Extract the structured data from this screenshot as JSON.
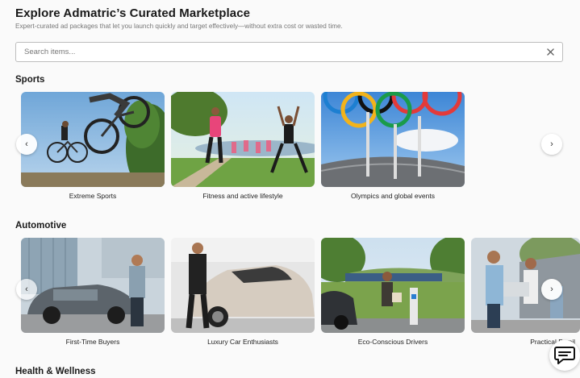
{
  "header": {
    "title": "Explore Admatric’s Curated Marketplace",
    "subtitle": "Expert-curated ad packages that let you launch quickly and target effectively—without extra cost or wasted time."
  },
  "search": {
    "placeholder": "Search items...",
    "value": ""
  },
  "sections": [
    {
      "title": "Sports",
      "cards": [
        {
          "caption": "Extreme Sports"
        },
        {
          "caption": "Fitness and active lifestyle"
        },
        {
          "caption": "Olympics and global events"
        }
      ]
    },
    {
      "title": "Automotive",
      "cards": [
        {
          "caption": "First-Time Buyers"
        },
        {
          "caption": "Luxury Car Enthusiasts"
        },
        {
          "caption": "Eco-Conscious Drivers"
        },
        {
          "caption": "Practical Famil"
        }
      ]
    },
    {
      "title": "Health & Wellness"
    }
  ],
  "icons": {
    "prev": "‹",
    "next": "›",
    "clear": "close-icon",
    "chat": "chat-icon"
  }
}
